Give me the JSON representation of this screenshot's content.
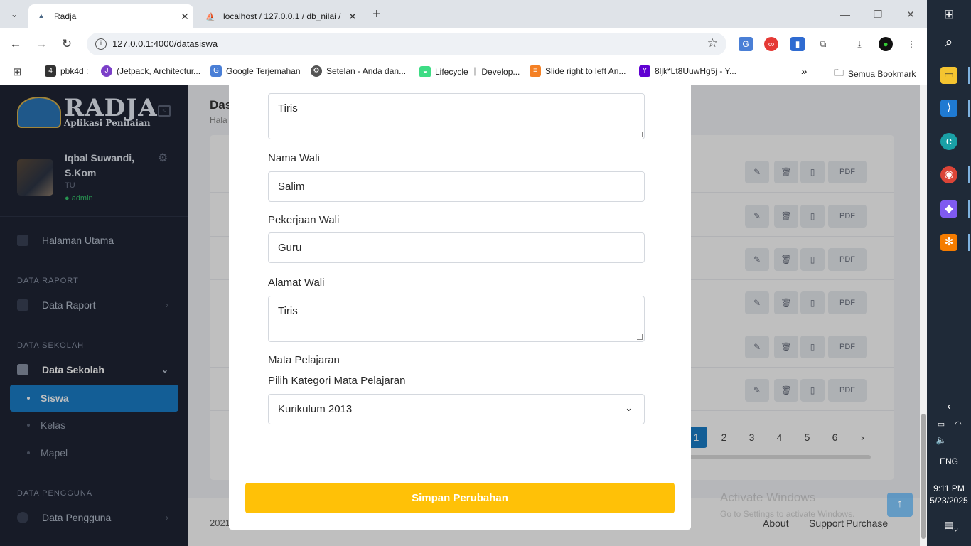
{
  "browser": {
    "tabs": [
      {
        "title": "Radja",
        "close": "✕"
      },
      {
        "title": "localhost / 127.0.0.1 / db_nilai /",
        "close": "✕"
      }
    ],
    "new_tab": "+",
    "url": "127.0.0.1:4000/datasiswa",
    "bookmarks": [
      {
        "label": "pbk4d :"
      },
      {
        "label": "(Jetpack, Architectur..."
      },
      {
        "label": "Google Terjemahan"
      },
      {
        "label": "Setelan - Anda dan..."
      },
      {
        "label": "Lifecycle ｜ Develop..."
      },
      {
        "label": "Slide right to left An..."
      },
      {
        "label": "8ljk*Lt8UuwHg5j - Y..."
      }
    ],
    "bookmarks_more": "»",
    "all_bookmarks": "Semua Bookmark"
  },
  "sidebar": {
    "logo_title": "RADJA",
    "logo_subtitle": "Aplikasi Penilaian",
    "profile": {
      "name": "Iqbal Suwandi, S.Kom",
      "role": "TU",
      "status": "● admin"
    },
    "home": "Halaman Utama",
    "sections": {
      "raport": "DATA RAPORT",
      "sekolah": "DATA SEKOLAH",
      "pengguna": "DATA PENGGUNA"
    },
    "items": {
      "raport": "Data Raport",
      "sekolah": "Data Sekolah",
      "siswa": "Siswa",
      "kelas": "Kelas",
      "mapel": "Mapel",
      "pengguna": "Data Pengguna"
    }
  },
  "main": {
    "title": "Das",
    "crumb": "Hala",
    "pdf_label": "PDF",
    "pagination": [
      "1",
      "2",
      "3",
      "4",
      "5",
      "6",
      "›"
    ],
    "footer_copy": "2021",
    "footer_links": [
      "About",
      "Support",
      "Purchase"
    ]
  },
  "watermark": {
    "title": "Activate Windows",
    "sub": "Go to Settings to activate Windows."
  },
  "modal": {
    "fields": [
      {
        "label": "Nama Wali",
        "value": "Salim"
      },
      {
        "label": "Pekerjaan Wali",
        "value": "Guru"
      },
      {
        "label": "Alamat Wali",
        "value": "Tiris"
      }
    ],
    "top_textarea_value": "Tiris",
    "mapel_heading": "Mata Pelajaran",
    "kategori_label": "Pilih Kategori Mata Pelajaran",
    "kategori_value": "Kurikulum 2013",
    "save_label": "Simpan Perubahan"
  },
  "taskbar": {
    "lang": "ENG",
    "time": "9:11 PM",
    "date": "5/23/2025",
    "notif_count": "2"
  },
  "colors": {
    "primary": "#1a7ec9",
    "save": "#ffc107",
    "sidebar": "#1f2535"
  }
}
